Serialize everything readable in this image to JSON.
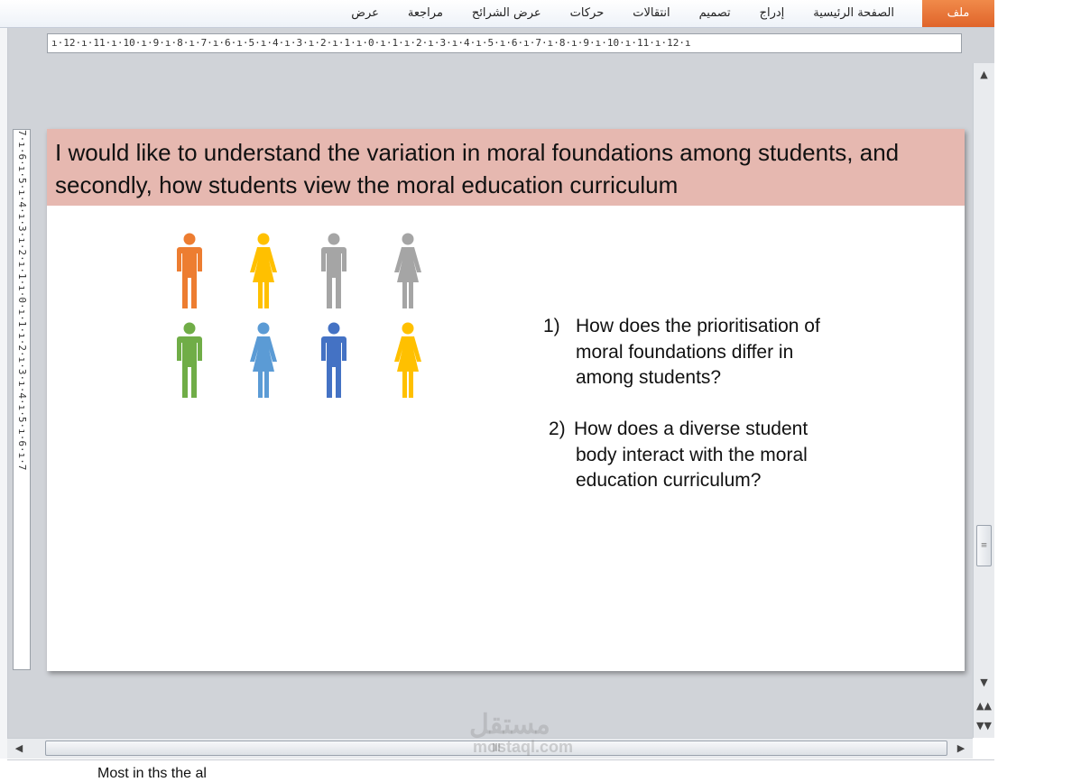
{
  "ribbon": {
    "file_tab": "ملف",
    "tabs": [
      "الصفحة الرئيسية",
      "إدراج",
      "تصميم",
      "انتقالات",
      "حركات",
      "عرض الشرائح",
      "مراجعة",
      "عرض"
    ]
  },
  "ruler": {
    "horizontal": "ı·12·ı·11·ı·10·ı·9·ı·8·ı·7·ı·6·ı·5·ı·4·ı·3·ı·2·ı·1·ı·0·ı·1·ı·2·ı·3·ı·4·ı·5·ı·6·ı·7·ı·8·ı·9·ı·10·ı·11·ı·12·ı",
    "vertical": "7·ı·6·ı·5·ı·4·ı·3·ı·2·ı·1·ı·0·ı·1·ı·2·ı·3·ı·4·ı·5·ı·6·ı·7"
  },
  "slide": {
    "title": "I would like to understand the variation in moral foundations among students, and secondly, how students view the moral education curriculum",
    "q1_num": "1)",
    "q1_lines": [
      "How does the prioritisation of",
      "moral foundations  differ in",
      "among students?"
    ],
    "q2_num": "2)",
    "q2_lines": [
      "How does a diverse student",
      "body interact with the moral",
      "education  curriculum?"
    ],
    "figures": [
      {
        "icon": "man-icon",
        "color": "#ed7d31"
      },
      {
        "icon": "woman-icon",
        "color": "#ffc000"
      },
      {
        "icon": "man-icon",
        "color": "#a5a5a5"
      },
      {
        "icon": "woman-icon",
        "color": "#a5a5a5"
      },
      {
        "icon": "man-icon",
        "color": "#70ad47"
      },
      {
        "icon": "woman-icon",
        "color": "#5b9bd5"
      },
      {
        "icon": "man-icon",
        "color": "#4472c4"
      },
      {
        "icon": "woman-icon",
        "color": "#ffc000"
      }
    ]
  },
  "watermark": {
    "line1": "مستقل",
    "line2": "mostaql.com"
  },
  "notes": {
    "text": "Most in ths the al"
  }
}
